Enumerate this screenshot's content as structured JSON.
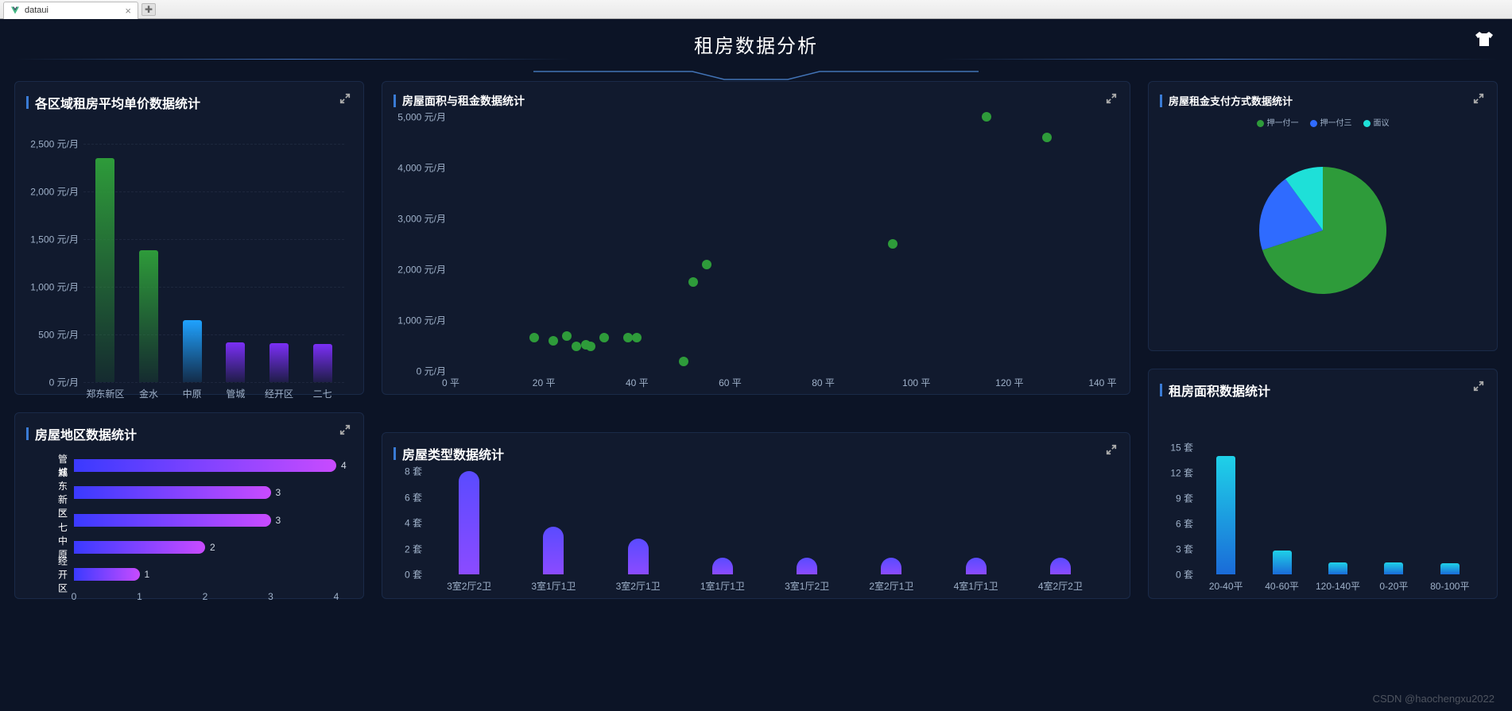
{
  "browser": {
    "tab_title": "dataui"
  },
  "page_title": "租房数据分析",
  "panels": {
    "avg_price": {
      "title": "各区域租房平均单价数据统计"
    },
    "area_rent": {
      "title": "房屋面积与租金数据统计"
    },
    "pay_method": {
      "title": "房屋租金支付方式数据统计",
      "legend": [
        "押一付一",
        "押一付三",
        "面议"
      ]
    },
    "region_count": {
      "title": "房屋地区数据统计"
    },
    "house_type": {
      "title": "房屋类型数据统计"
    },
    "area_count": {
      "title": "租房面积数据统计"
    }
  },
  "chart_data": [
    {
      "id": "avg_price",
      "type": "bar",
      "title": "各区域租房平均单价数据统计",
      "ylabel": "元/月",
      "ylim": [
        0,
        2500
      ],
      "categories": [
        "郑东新区",
        "金水",
        "中原",
        "管城",
        "经开区",
        "二七"
      ],
      "values": [
        2350,
        1380,
        650,
        420,
        410,
        400
      ],
      "y_ticks": [
        0,
        500,
        1000,
        1500,
        2000,
        2500
      ],
      "colors": [
        "#2e9b3a",
        "#2e9b3a",
        "#1fa2ff",
        "#7b2ff7",
        "#7b2ff7",
        "#7b2ff7"
      ]
    },
    {
      "id": "area_rent",
      "type": "scatter",
      "title": "房屋面积与租金数据统计",
      "xlabel": "平",
      "ylabel": "元/月",
      "xlim": [
        0,
        140
      ],
      "ylim": [
        0,
        5000
      ],
      "x_ticks": [
        0,
        20,
        40,
        60,
        80,
        100,
        120,
        140
      ],
      "y_ticks": [
        0,
        1000,
        2000,
        3000,
        4000,
        5000
      ],
      "points": [
        [
          18,
          650
        ],
        [
          22,
          600
        ],
        [
          25,
          680
        ],
        [
          27,
          490
        ],
        [
          29,
          520
        ],
        [
          30,
          490
        ],
        [
          33,
          650
        ],
        [
          38,
          660
        ],
        [
          40,
          660
        ],
        [
          50,
          180
        ],
        [
          52,
          1750
        ],
        [
          55,
          2100
        ],
        [
          95,
          2500
        ],
        [
          115,
          5000
        ],
        [
          128,
          4600
        ]
      ]
    },
    {
      "id": "pay_method",
      "type": "pie",
      "title": "房屋租金支付方式数据统计",
      "series": [
        {
          "name": "押一付一",
          "value": 70,
          "color": "#2e9b3a"
        },
        {
          "name": "押一付三",
          "value": 20,
          "color": "#2f6bff"
        },
        {
          "name": "面议",
          "value": 10,
          "color": "#1ee0d8"
        }
      ]
    },
    {
      "id": "region_count",
      "type": "bar",
      "orientation": "horizontal",
      "title": "房屋地区数据统计",
      "xlabel": "",
      "xlim": [
        0,
        4
      ],
      "x_ticks": [
        0,
        1,
        2,
        3,
        4
      ],
      "categories": [
        "管城",
        "郑东新区",
        "二七",
        "中原",
        "经开区"
      ],
      "values": [
        4,
        3,
        3,
        2,
        1
      ]
    },
    {
      "id": "house_type",
      "type": "bar",
      "title": "房屋类型数据统计",
      "ylabel": "套",
      "ylim": [
        0,
        8
      ],
      "y_ticks": [
        0,
        2,
        4,
        6,
        8
      ],
      "categories": [
        "3室2厅2卫",
        "3室1厅1卫",
        "3室2厅1卫",
        "1室1厅1卫",
        "3室1厅2卫",
        "2室2厅1卫",
        "4室1厅1卫",
        "4室2厅2卫"
      ],
      "values": [
        8,
        3.7,
        2.8,
        1.3,
        1.3,
        1.3,
        1.3,
        1.3
      ]
    },
    {
      "id": "area_count",
      "type": "bar",
      "title": "租房面积数据统计",
      "ylabel": "套",
      "ylim": [
        0,
        15
      ],
      "y_ticks": [
        0,
        3,
        6,
        9,
        12,
        15
      ],
      "categories": [
        "20-40平",
        "40-60平",
        "120-140平",
        "0-20平",
        "80-100平"
      ],
      "values": [
        14,
        2.8,
        1.4,
        1.4,
        1.3
      ]
    }
  ],
  "watermark": "CSDN @haochengxu2022"
}
